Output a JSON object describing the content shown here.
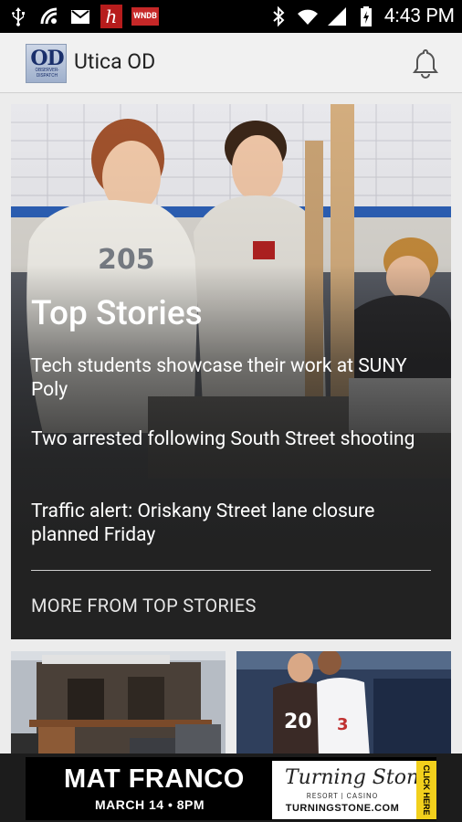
{
  "status_bar": {
    "time": "4:43 PM",
    "left_icons": [
      "usb-icon",
      "sync-icon",
      "gmail-icon",
      "h-app-icon",
      "wndb-app-icon"
    ],
    "right_icons": [
      "bluetooth-icon",
      "wifi-icon",
      "signal-icon",
      "battery-charging-icon"
    ],
    "h_label": "h",
    "wndb_label": "WNDB"
  },
  "app_bar": {
    "logo_text": "OD",
    "logo_sub": "OBSERVER-DISPATCH",
    "title": "Utica OD",
    "notification_icon": "bell-icon"
  },
  "hero": {
    "heading": "Top Stories",
    "stories": [
      "Tech students showcase their work at SUNY Poly",
      "Two arrested following South Street shooting",
      "Traffic alert: Oriskany Street lane closure planned Friday"
    ],
    "more_label": "MORE FROM TOP STORIES"
  },
  "ad": {
    "performer": "MAT FRANCO",
    "date": "MARCH 14 • 8PM",
    "brand": "Turning Stone",
    "brand_sub": "RESORT | CASINO",
    "url": "TURNINGSTONE.COM",
    "cta": "CLICK HERE"
  },
  "colors": {
    "status_bar": "#000000",
    "app_bar": "#f1f1f1",
    "hero_overlay": "#222222",
    "ad_cta": "#f2d01c"
  }
}
